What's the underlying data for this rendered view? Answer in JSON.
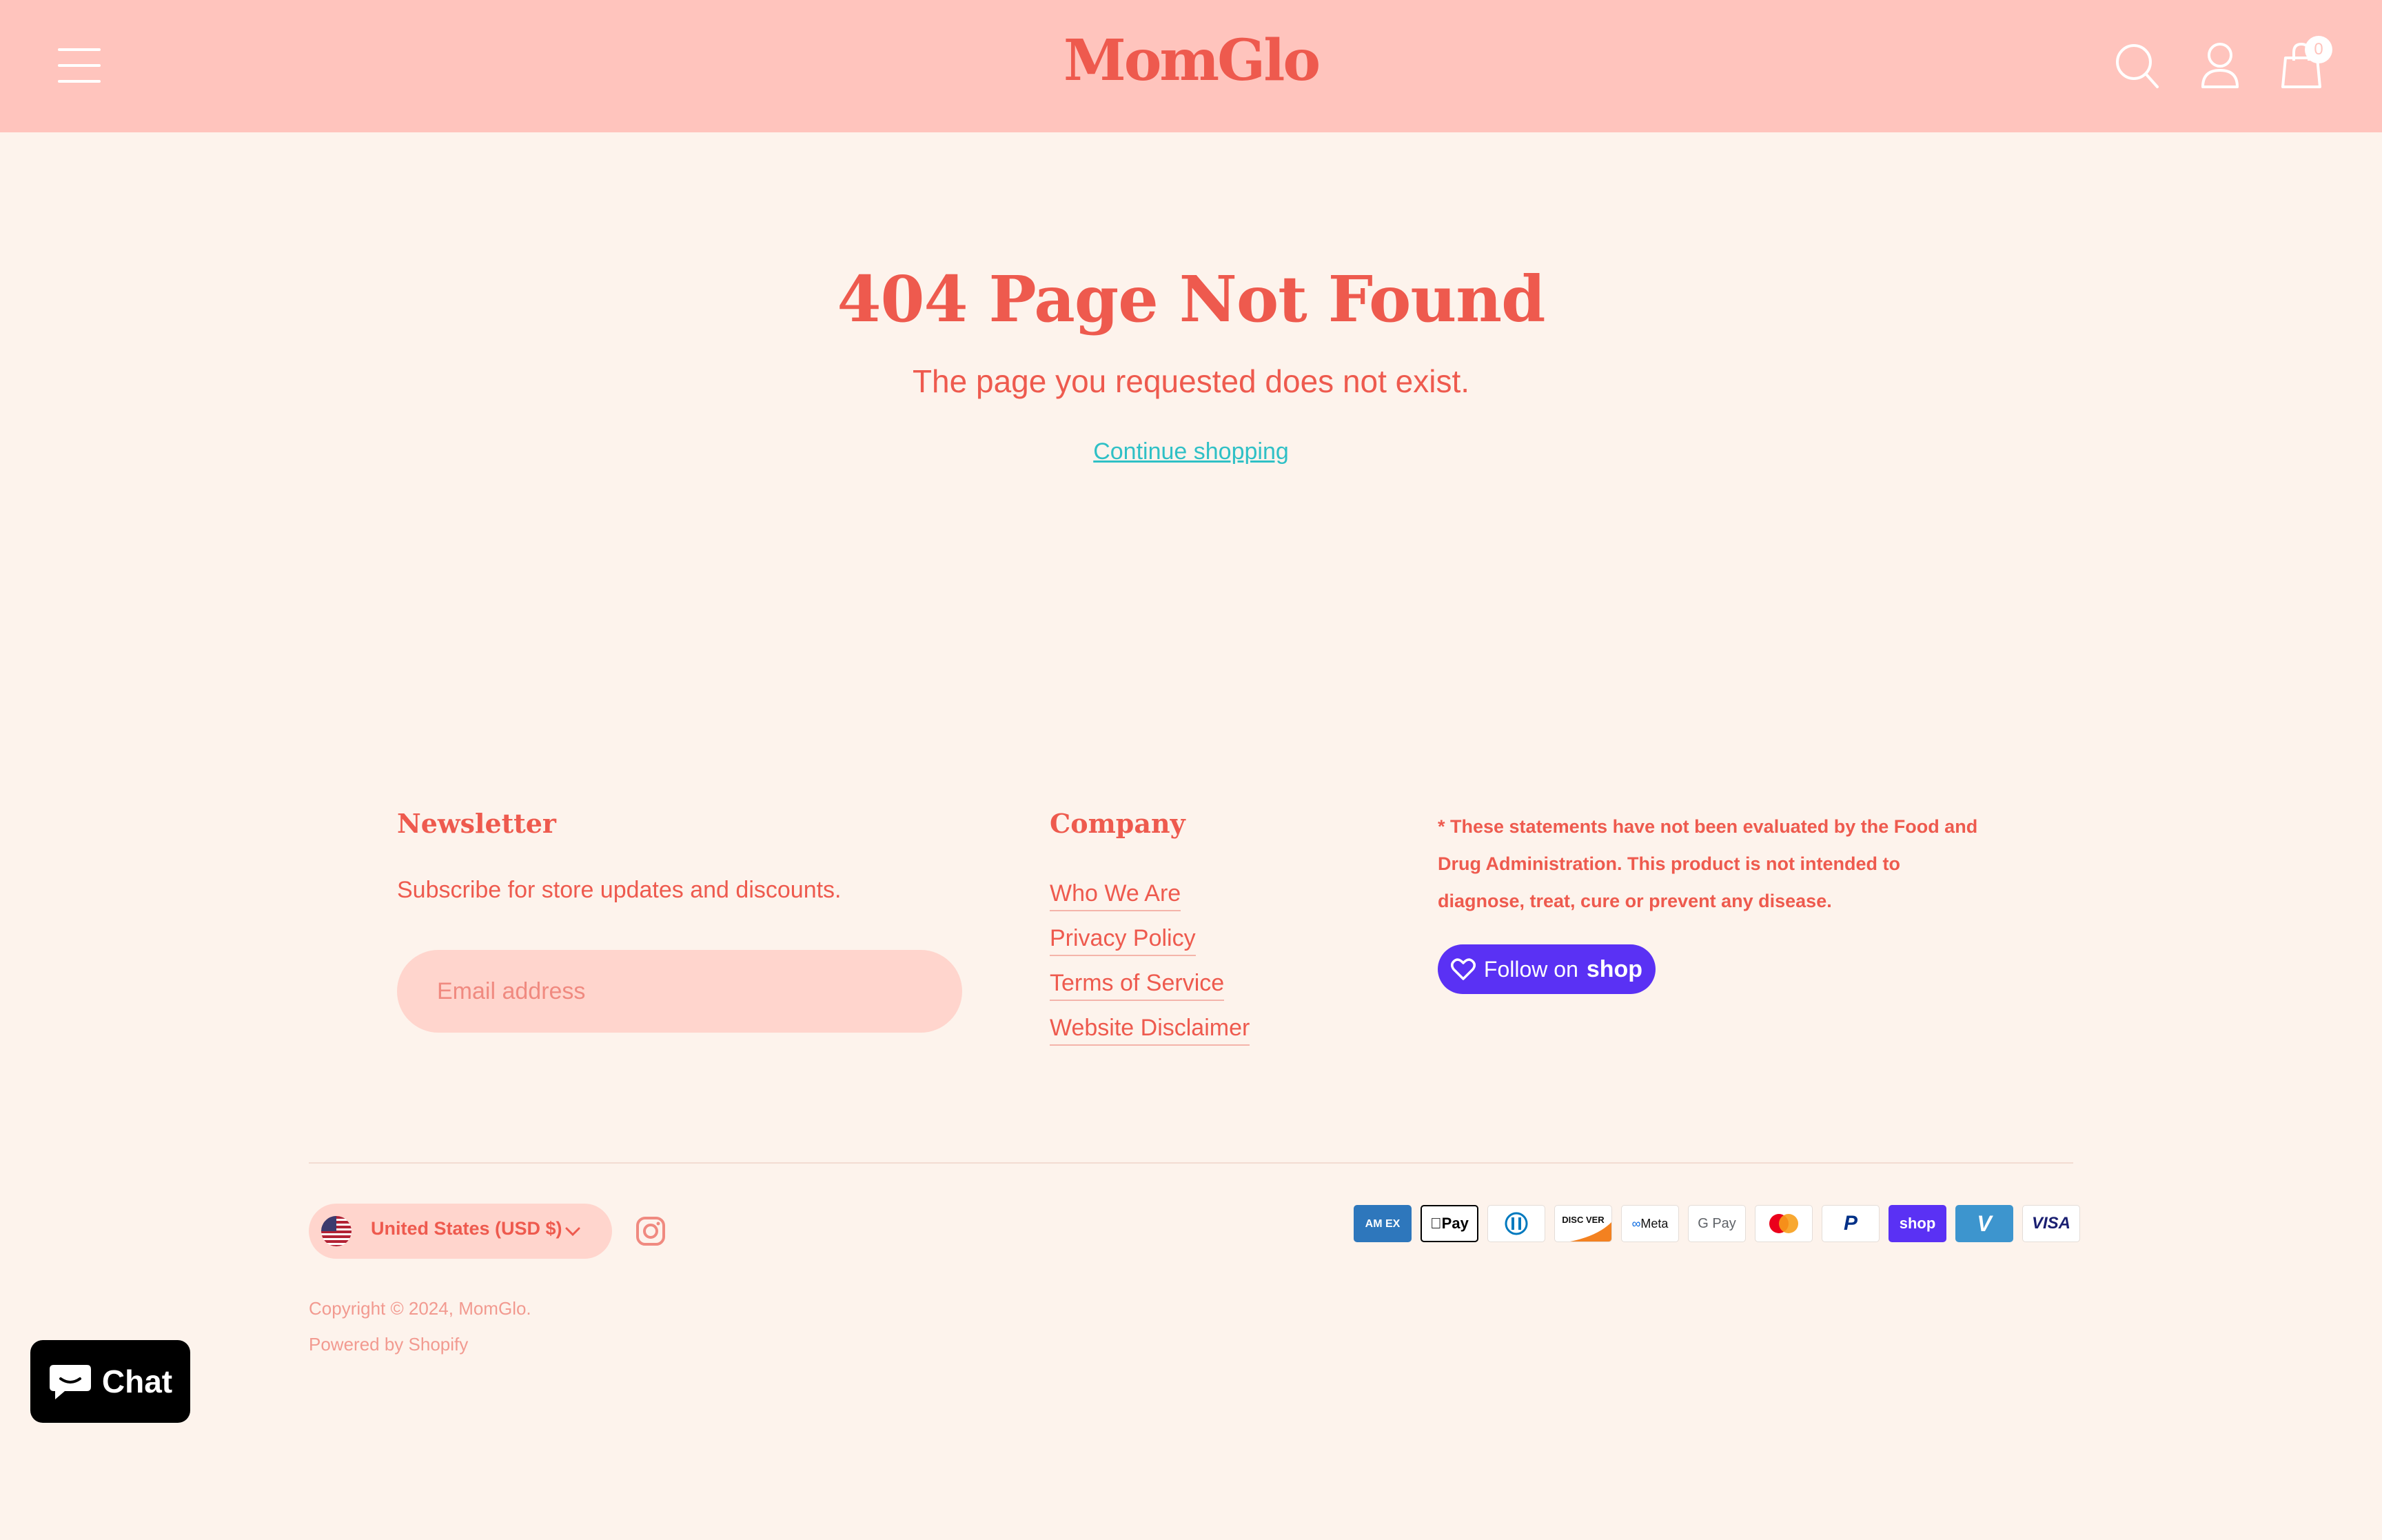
{
  "header": {
    "logo_text": "MomGlo",
    "cart_count": "0"
  },
  "main": {
    "title": "404 Page Not Found",
    "subtitle": "The page you requested does not exist.",
    "continue_link": "Continue shopping"
  },
  "footer": {
    "newsletter": {
      "heading": "Newsletter",
      "text": "Subscribe for store updates and discounts.",
      "email_placeholder": "Email address"
    },
    "company": {
      "heading": "Company",
      "links": [
        "Who We Are",
        "Privacy Policy",
        "Terms of Service",
        "Website Disclaimer"
      ]
    },
    "disclaimer": "* These statements have not been evaluated by the Food and Drug Administration. This product is not intended to diagnose, treat, cure or prevent any disease.",
    "follow": {
      "prefix": "Follow on",
      "brand": "shop"
    },
    "country": "United States (USD $)",
    "copyright_prefix": "Copyright © 2024,",
    "copyright_link": "MomGlo.",
    "powered_by": "Powered by Shopify",
    "payment_icons": [
      "american-express",
      "apple-pay",
      "diners-club",
      "discover",
      "meta-pay",
      "google-pay",
      "mastercard",
      "paypal",
      "shop-pay",
      "venmo",
      "visa"
    ],
    "payment_labels": {
      "amex": "AM EX",
      "applepay": "Pay",
      "discover": "DISC VER",
      "meta": "Meta",
      "gpay": "G Pay",
      "shoppay": "shop",
      "visa": "VISA"
    }
  },
  "chat": {
    "label": "Chat"
  },
  "colors": {
    "header_bg": "#ffc4bd",
    "page_bg": "#fdf3ec",
    "accent": "#ee5a4e",
    "link": "#2fc0c6",
    "shop_purple": "#5a31f4"
  }
}
